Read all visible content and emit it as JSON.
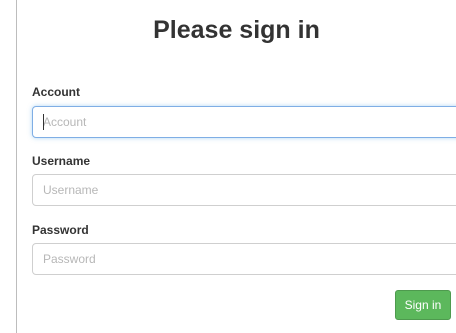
{
  "form": {
    "title": "Please sign in",
    "account": {
      "label": "Account",
      "placeholder": "Account",
      "value": ""
    },
    "username": {
      "label": "Username",
      "placeholder": "Username",
      "value": ""
    },
    "password": {
      "label": "Password",
      "placeholder": "Password",
      "value": ""
    },
    "submit_label": "Sign in"
  },
  "colors": {
    "button": "#5cb85c",
    "focus_border": "#7faee5"
  }
}
